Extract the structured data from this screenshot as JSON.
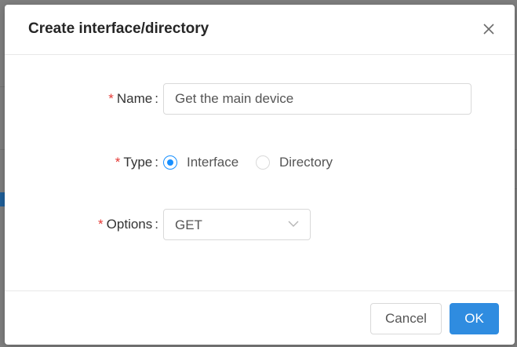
{
  "modal": {
    "title": "Create interface/directory"
  },
  "form": {
    "name": {
      "label": "Name",
      "required_mark": "*",
      "value": "Get the main device"
    },
    "type": {
      "label": "Type",
      "required_mark": "*",
      "options": [
        {
          "label": "Interface",
          "checked": true
        },
        {
          "label": "Directory",
          "checked": false
        }
      ]
    },
    "options": {
      "label": "Options",
      "required_mark": "*",
      "selected": "GET"
    }
  },
  "footer": {
    "cancel_label": "Cancel",
    "ok_label": "OK"
  },
  "icons": {
    "close": "close-icon",
    "dropdown": "chevron-down-icon"
  },
  "colors": {
    "primary": "#2f8ce0",
    "radio_checked": "#1890ff",
    "required": "#e53935",
    "overlay": "#7f7f7f"
  }
}
